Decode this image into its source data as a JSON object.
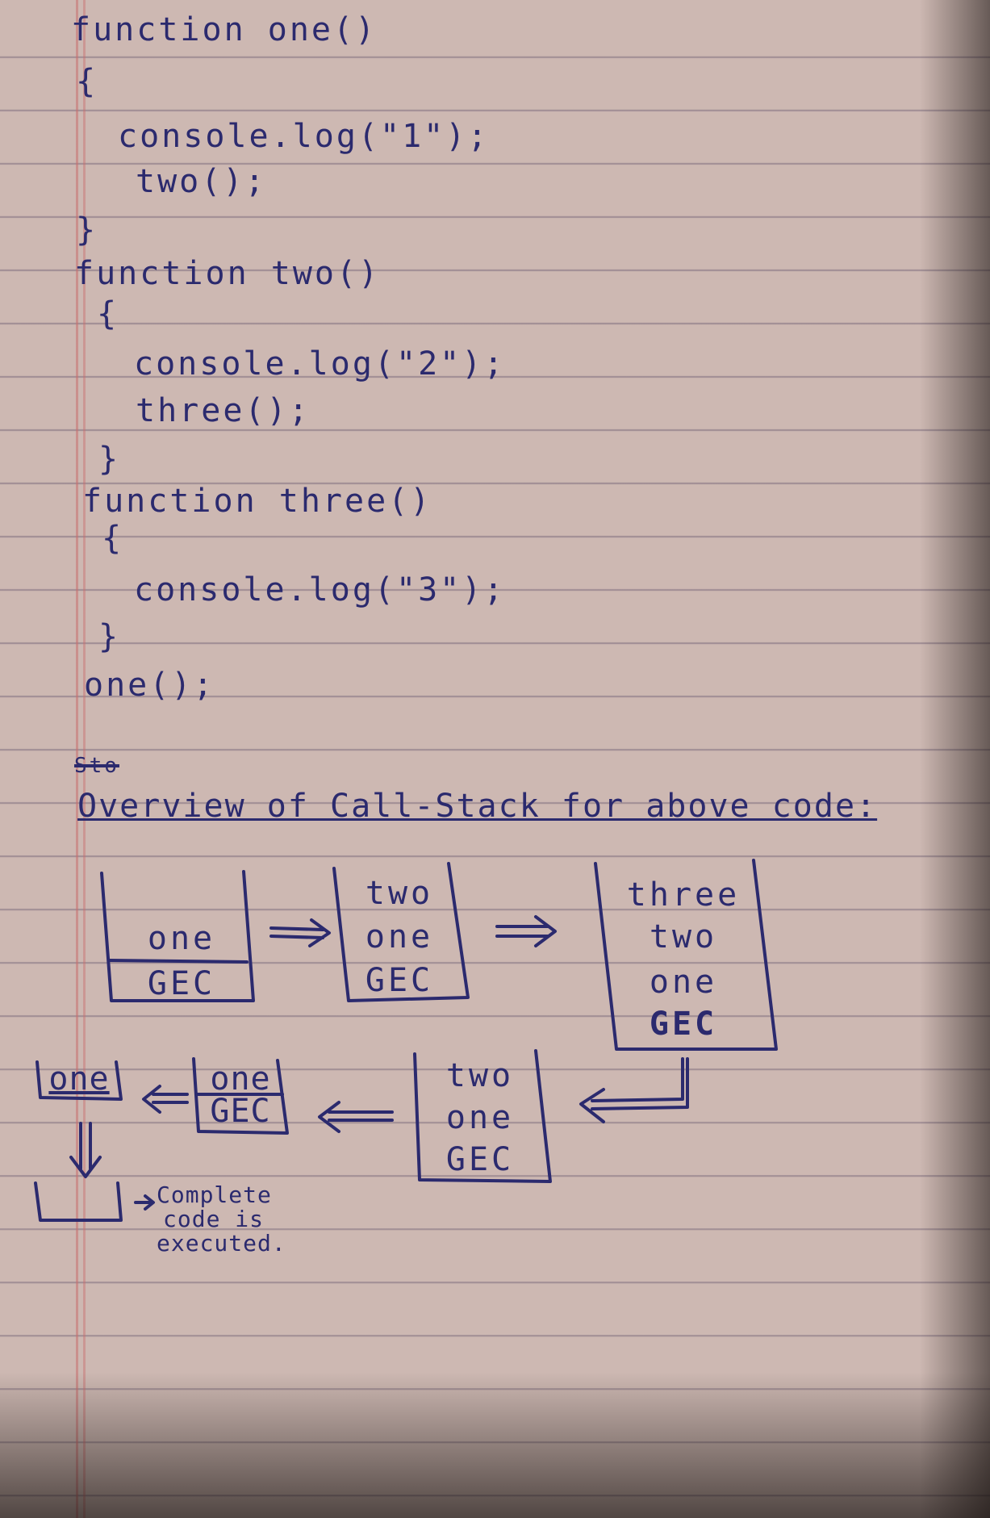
{
  "code_lines": [
    "function one()",
    "{",
    "console.log(\"1\");",
    "two();",
    "}",
    "function two()",
    "{",
    "console.log(\"2\");",
    "three();",
    "}",
    "function three()",
    "{",
    "console.log(\"3\");",
    "}",
    "one();"
  ],
  "struck_text": "Sto",
  "title": "Overview of Call-Stack for above code:",
  "stacks_row1": [
    [
      "one",
      "GEC"
    ],
    [
      "two",
      "one",
      "GEC"
    ],
    [
      "three",
      "two",
      "one",
      "GEC"
    ]
  ],
  "stacks_row2": [
    [
      "two",
      "one",
      "GEC"
    ],
    [
      "one",
      "GEC"
    ],
    [
      "one"
    ]
  ],
  "final_note": [
    "Complete",
    "code is",
    "executed."
  ]
}
